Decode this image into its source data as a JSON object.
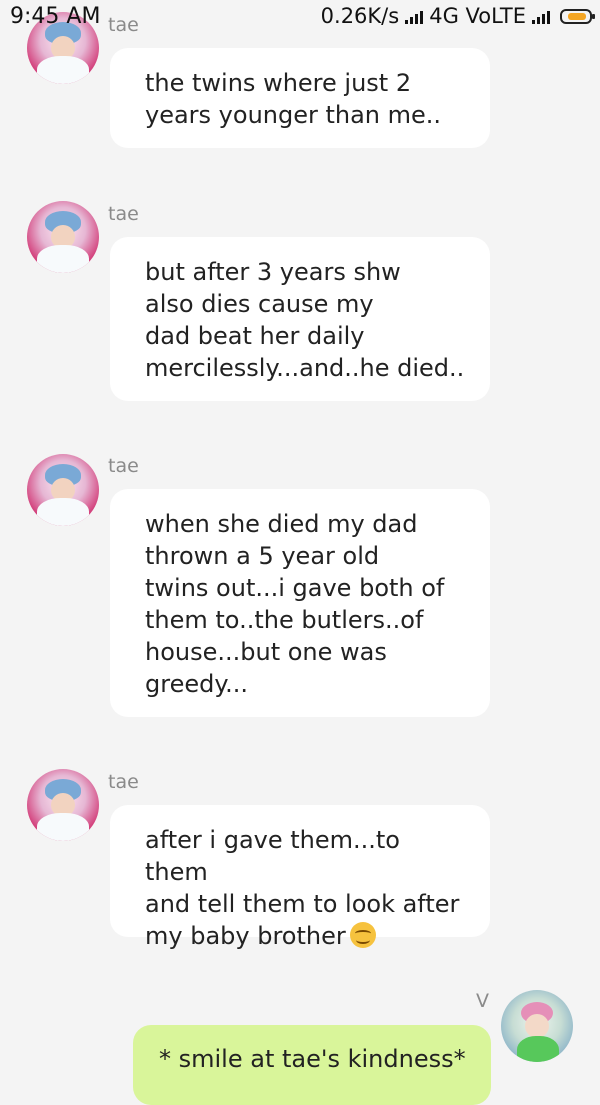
{
  "status_bar": {
    "time": "9:45 AM",
    "speed": "0.26K/s",
    "network": "4G VoLTE"
  },
  "messages": [
    {
      "sender": "tae",
      "text": "the twins where just 2\nyears younger than me.."
    },
    {
      "sender": "tae",
      "text": "but after 3 years shw\nalso dies cause my\ndad beat her daily\nmercilessly...and..he died.."
    },
    {
      "sender": "tae",
      "text": "when she died my dad\nthrown a 5 year old\ntwins out...i gave both of\nthem to..the butlers..of\nhouse...but one was\ngreedy..."
    },
    {
      "sender": "tae",
      "text": "after i gave them...to them\nand tell them to look after\nmy baby brother"
    }
  ],
  "my_message": {
    "sender": "V",
    "text": "* smile at tae's kindness*"
  },
  "colors": {
    "background": "#f4f4f4",
    "incoming_bubble": "#ffffff",
    "outgoing_bubble": "#d9f59a",
    "battery": "#f5a623"
  },
  "icons": [
    "signal-icon",
    "battery-icon",
    "smiling-emoji-icon",
    "avatar-icon"
  ]
}
